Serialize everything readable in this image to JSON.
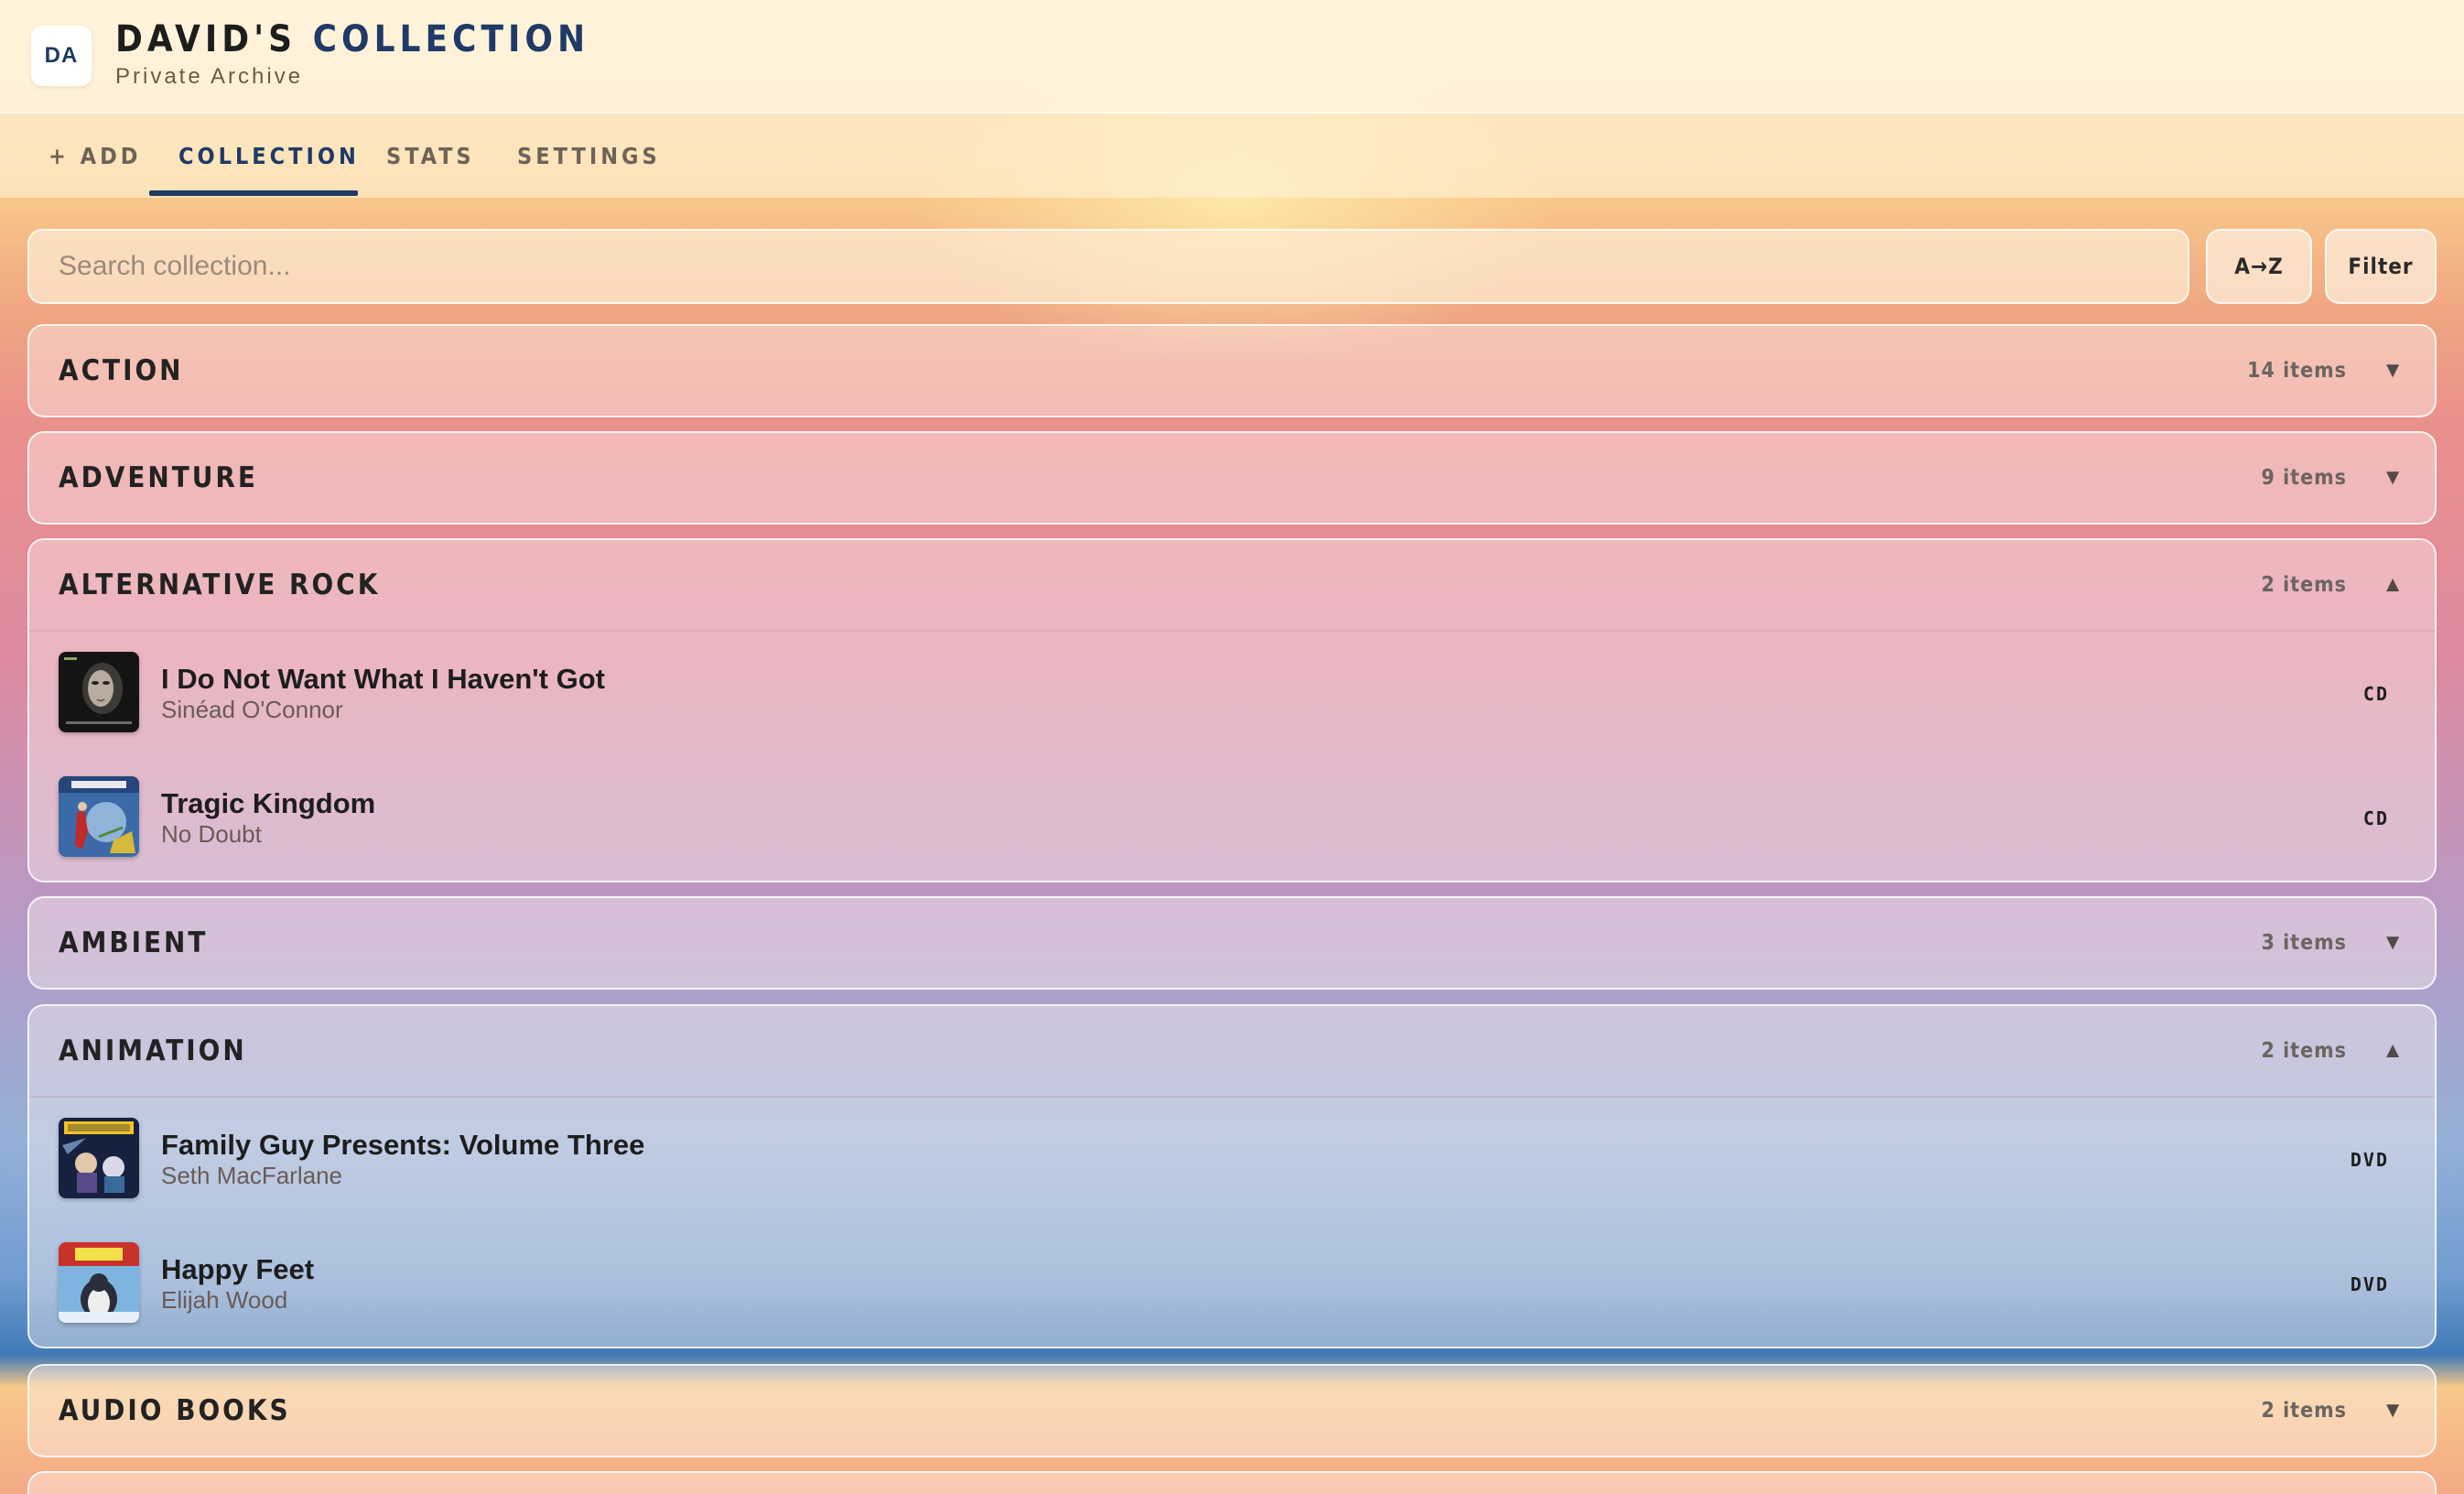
{
  "header": {
    "avatar_initials": "DA",
    "title_prefix": "DAVID'S",
    "title_accent": "COLLECTION",
    "subtitle": "Private Archive"
  },
  "tabs": [
    {
      "label": "+ ADD",
      "active": false
    },
    {
      "label": "COLLECTION",
      "active": true
    },
    {
      "label": "STATS",
      "active": false
    },
    {
      "label": "SETTINGS",
      "active": false
    }
  ],
  "search": {
    "placeholder": "Search collection...",
    "value": ""
  },
  "toolbar": {
    "sort_label": "A→Z",
    "filter_label": "Filter"
  },
  "groups": [
    {
      "name": "ACTION",
      "count": "14 items",
      "expanded": false,
      "chevron": "▼",
      "chevron_icon": "chevron-down-icon",
      "items": []
    },
    {
      "name": "ADVENTURE",
      "count": "9 items",
      "expanded": false,
      "chevron": "▼",
      "chevron_icon": "chevron-down-icon",
      "items": []
    },
    {
      "name": "ALTERNATIVE ROCK",
      "count": "2 items",
      "expanded": true,
      "chevron": "▲",
      "chevron_icon": "chevron-up-icon",
      "items": [
        {
          "title": "I Do Not Want What I Haven't Got",
          "creator": "Sinéad O'Connor",
          "format": "CD"
        },
        {
          "title": "Tragic Kingdom",
          "creator": "No Doubt",
          "format": "CD"
        }
      ]
    },
    {
      "name": "AMBIENT",
      "count": "3 items",
      "expanded": false,
      "chevron": "▼",
      "chevron_icon": "chevron-down-icon",
      "items": []
    },
    {
      "name": "ANIMATION",
      "count": "2 items",
      "expanded": true,
      "chevron": "▲",
      "chevron_icon": "chevron-up-icon",
      "items": [
        {
          "title": "Family Guy Presents: Volume Three",
          "creator": "Seth MacFarlane",
          "format": "DVD"
        },
        {
          "title": "Happy Feet",
          "creator": "Elijah Wood",
          "format": "DVD"
        }
      ]
    },
    {
      "name": "AUDIO BOOKS",
      "count": "2 items",
      "expanded": false,
      "chevron": "▼",
      "chevron_icon": "chevron-down-icon",
      "items": []
    }
  ],
  "colors": {
    "accent": "#1f3a66"
  }
}
